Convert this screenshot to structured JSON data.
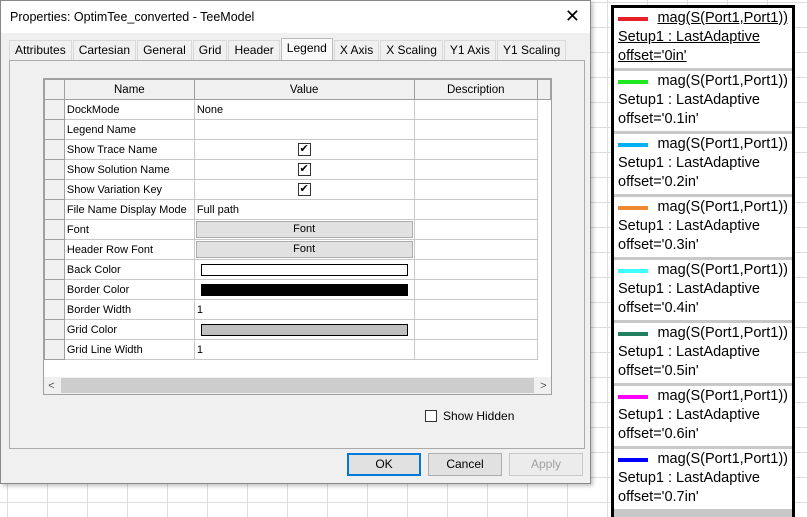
{
  "dialog": {
    "title": "Properties: OptimTee_converted - TeeModel",
    "close_icon": "close-icon",
    "tabs": [
      "Attributes",
      "Cartesian",
      "General",
      "Grid",
      "Header",
      "Legend",
      "X Axis",
      "X Scaling",
      "Y1 Axis",
      "Y1 Scaling"
    ],
    "active_tab": "Legend",
    "columns": [
      "Name",
      "Value",
      "Description"
    ],
    "rows": [
      {
        "name": "DockMode",
        "type": "text",
        "value": "None"
      },
      {
        "name": "Legend Name",
        "type": "text",
        "value": ""
      },
      {
        "name": "Show Trace Name",
        "type": "check",
        "value": "✔"
      },
      {
        "name": "Show Solution Name",
        "type": "check",
        "value": "✔"
      },
      {
        "name": "Show Variation Key",
        "type": "check",
        "value": "✔"
      },
      {
        "name": "File Name Display Mode",
        "type": "text",
        "value": "Full path"
      },
      {
        "name": "Font",
        "type": "button",
        "value": "Font"
      },
      {
        "name": "Header Row Font",
        "type": "button",
        "value": "Font"
      },
      {
        "name": "Back Color",
        "type": "color",
        "value": "#ffffff"
      },
      {
        "name": "Border Color",
        "type": "color",
        "value": "#000000"
      },
      {
        "name": "Border Width",
        "type": "text",
        "value": "1"
      },
      {
        "name": "Grid Color",
        "type": "color",
        "value": "#c0c0c0"
      },
      {
        "name": "Grid Line Width",
        "type": "text",
        "value": "1"
      }
    ],
    "show_hidden": {
      "label": "Show Hidden",
      "checked": false
    },
    "buttons": {
      "ok": "OK",
      "cancel": "Cancel",
      "apply": "Apply"
    }
  },
  "legend": {
    "entries": [
      {
        "trace": "mag(S(Port1,Port1))",
        "setup": "Setup1 : LastAdaptive",
        "offset": "offset='0in'",
        "color": "#e82028",
        "selected": true
      },
      {
        "trace": "mag(S(Port1,Port1))",
        "setup": "Setup1 : LastAdaptive",
        "offset": "offset='0.1in'",
        "color": "#20e820"
      },
      {
        "trace": "mag(S(Port1,Port1))",
        "setup": "Setup1 : LastAdaptive",
        "offset": "offset='0.2in'",
        "color": "#00b0f0"
      },
      {
        "trace": "mag(S(Port1,Port1))",
        "setup": "Setup1 : LastAdaptive",
        "offset": "offset='0.3in'",
        "color": "#f08830"
      },
      {
        "trace": "mag(S(Port1,Port1))",
        "setup": "Setup1 : LastAdaptive",
        "offset": "offset='0.4in'",
        "color": "#40ffff"
      },
      {
        "trace": "mag(S(Port1,Port1))",
        "setup": "Setup1 : LastAdaptive",
        "offset": "offset='0.5in'",
        "color": "#208060"
      },
      {
        "trace": "mag(S(Port1,Port1))",
        "setup": "Setup1 : LastAdaptive",
        "offset": "offset='0.6in'",
        "color": "#ff00ff"
      },
      {
        "trace": "mag(S(Port1,Port1))",
        "setup": "Setup1 : LastAdaptive",
        "offset": "offset='0.7in'",
        "color": "#0000ff"
      }
    ]
  }
}
